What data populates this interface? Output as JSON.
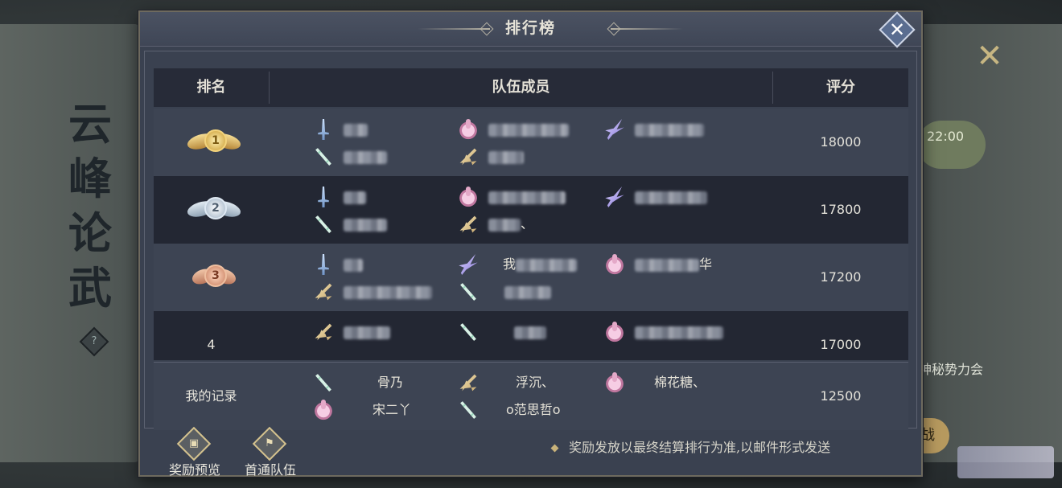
{
  "background": {
    "title_chars": [
      "云",
      "峰",
      "论",
      "武"
    ],
    "help_icon": "?",
    "time": "22:00",
    "side_text": "神秘势力会",
    "side_button": "战"
  },
  "dialog": {
    "title": "排行榜",
    "close_icon": "close-icon"
  },
  "table": {
    "headers": {
      "rank": "排名",
      "members": "队伍成员",
      "score": "评分"
    },
    "rows": [
      {
        "rank": 1,
        "medal": "gold",
        "score": "18000",
        "members": [
          {
            "class": "sword",
            "name": ""
          },
          {
            "class": "pink",
            "name": ""
          },
          {
            "class": "feather",
            "name": ""
          },
          {
            "class": "spear",
            "name": ""
          },
          {
            "class": "flute",
            "name": ""
          }
        ]
      },
      {
        "rank": 2,
        "medal": "silver",
        "score": "17800",
        "members": [
          {
            "class": "sword",
            "name": ""
          },
          {
            "class": "pink",
            "name": ""
          },
          {
            "class": "feather",
            "name": ""
          },
          {
            "class": "spear",
            "name": ""
          },
          {
            "class": "flute",
            "name": "、"
          }
        ]
      },
      {
        "rank": 3,
        "medal": "bronze",
        "score": "17200",
        "members": [
          {
            "class": "sword",
            "name": ""
          },
          {
            "class": "feather",
            "name": "我"
          },
          {
            "class": "pink",
            "name": "华"
          },
          {
            "class": "flute",
            "name": ""
          },
          {
            "class": "spear",
            "name": ""
          }
        ]
      },
      {
        "rank": 4,
        "medal": "",
        "rank_label": "4",
        "score": "17000",
        "members": [
          {
            "class": "flute",
            "name": ""
          },
          {
            "class": "spear",
            "name": ""
          },
          {
            "class": "pink",
            "name": ""
          }
        ]
      }
    ]
  },
  "my_record": {
    "label": "我的记录",
    "score": "12500",
    "members": [
      {
        "class": "spear",
        "name": "骨乃"
      },
      {
        "class": "flute",
        "name": "浮沉、"
      },
      {
        "class": "pink",
        "name": "棉花糖、"
      },
      {
        "class": "pink",
        "name": "宋二丫"
      },
      {
        "class": "spear",
        "name": "o范思哲o"
      }
    ]
  },
  "footer": {
    "reward_preview": "奖励预览",
    "first_clear": "首通队伍",
    "notice": "奖励发放以最终结算排行为准,以邮件形式发送"
  }
}
